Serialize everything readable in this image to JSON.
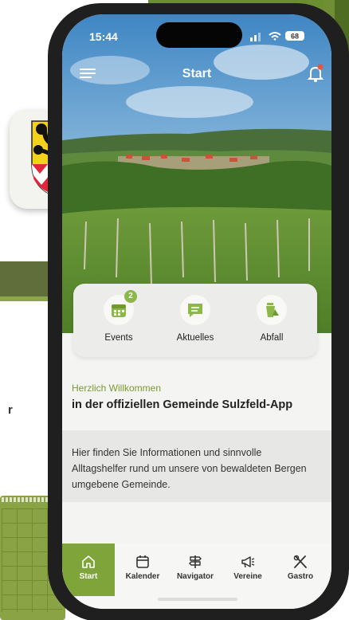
{
  "status_bar": {
    "time": "15:44",
    "battery": "68"
  },
  "header": {
    "title": "Start"
  },
  "quick_actions": [
    {
      "label": "Events",
      "icon": "calendar-icon",
      "badge": "2"
    },
    {
      "label": "Aktuelles",
      "icon": "news-icon"
    },
    {
      "label": "Abfall",
      "icon": "trash-icon"
    }
  ],
  "welcome": {
    "subtitle": "Herzlich Willkommen",
    "title": "in der offiziellen Gemeinde Sulzfeld-App",
    "text": "Hier finden Sie Informationen und sinnvolle Alltagshelfer rund um unsere von bewaldeten Bergen umgebene Gemeinde."
  },
  "tabbar": [
    {
      "label": "Start",
      "icon": "home-icon",
      "active": true
    },
    {
      "label": "Kalender",
      "icon": "calendar-icon"
    },
    {
      "label": "Navigator",
      "icon": "signpost-icon"
    },
    {
      "label": "Vereine",
      "icon": "megaphone-icon"
    },
    {
      "label": "Gastro",
      "icon": "cutlery-icon"
    }
  ],
  "side_text": "r",
  "colors": {
    "accent": "#7fa53a",
    "accent_text": "#7a9b2e",
    "badge": "#8cb84a",
    "notification_dot": "#e8543c"
  }
}
